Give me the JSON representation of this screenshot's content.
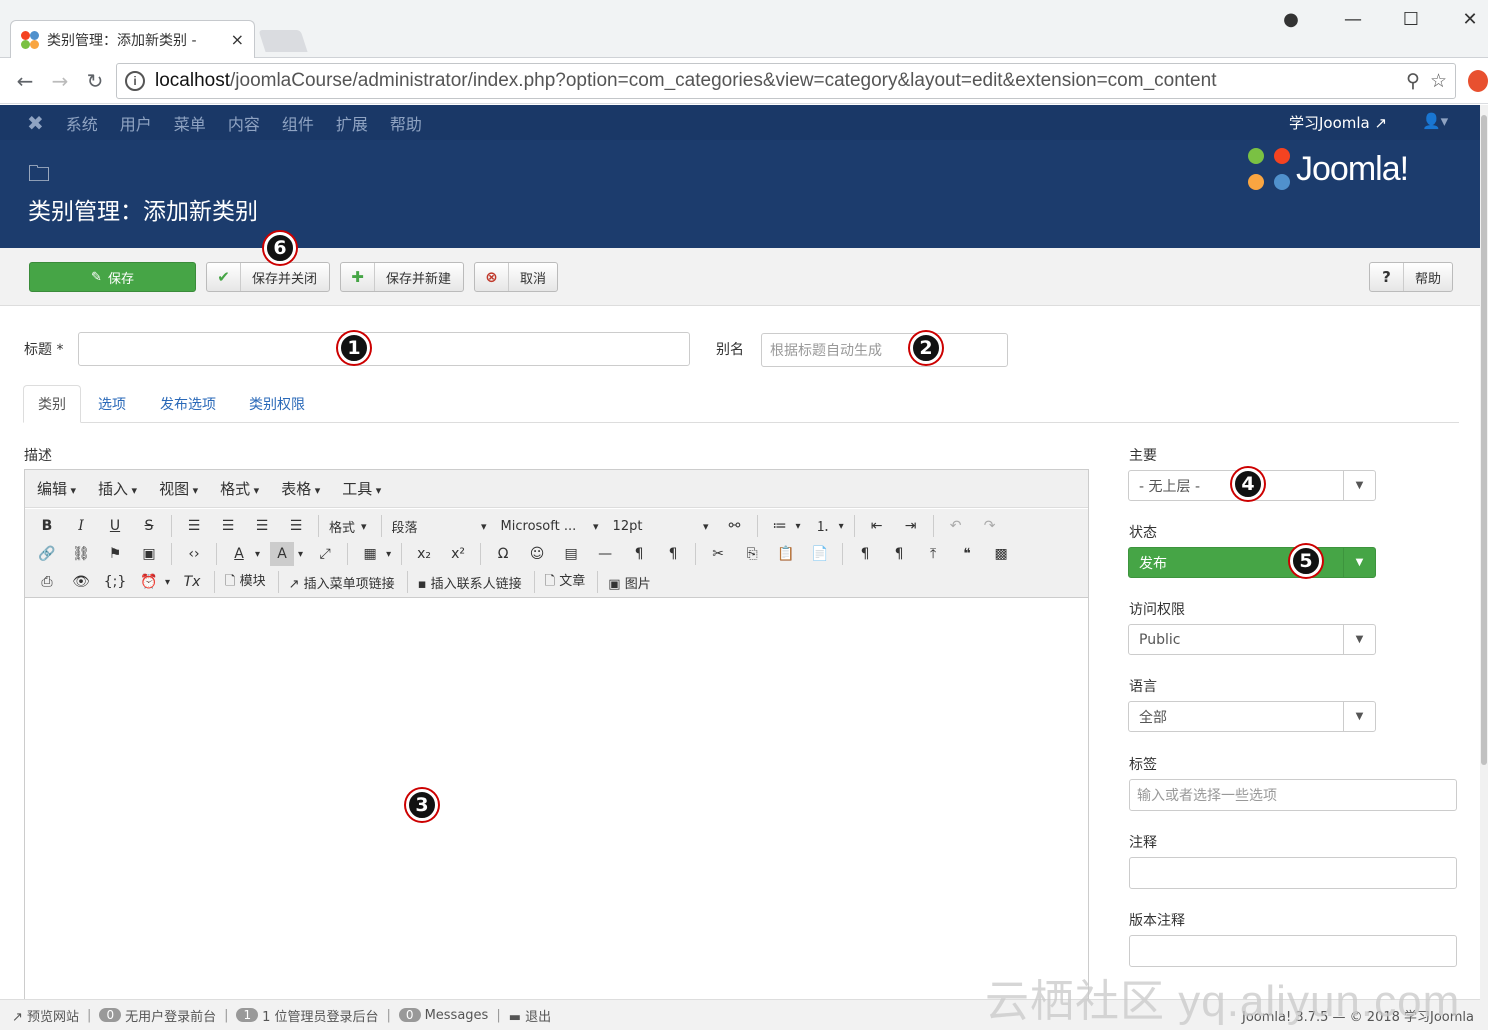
{
  "browser": {
    "tab_title": "类别管理：添加新类别 -",
    "tab_close": "×",
    "url_host": "localhost",
    "url_path": "/joomlaCourse/administrator/index.php?option=com_categories&view=category&layout=edit&extension=com_content",
    "info_icon": "i"
  },
  "admin_menu": {
    "items": [
      "系统",
      "用户",
      "菜单",
      "内容",
      "组件",
      "扩展",
      "帮助"
    ],
    "site_link": "学习Joomla"
  },
  "header": {
    "page_title": "类别管理：添加新类别",
    "logo_text": "Joomla!"
  },
  "toolbar": {
    "save": "保存",
    "save_close": "保存并关闭",
    "save_new": "保存并新建",
    "cancel": "取消",
    "help": "帮助"
  },
  "form": {
    "title_label": "标题 *",
    "alias_label": "别名",
    "alias_placeholder": "根据标题自动生成",
    "tabs": [
      "类别",
      "选项",
      "发布选项",
      "类别权限"
    ],
    "description_label": "描述"
  },
  "editor": {
    "menus": [
      "编辑",
      "插入",
      "视图",
      "格式",
      "表格",
      "工具"
    ],
    "formats_label": "格式",
    "block_label": "段落",
    "font_label": "Microsoft ...",
    "size_label": "12pt",
    "module_btn": "模块",
    "menu_link_btn": "插入菜单项链接",
    "contact_link_btn": "插入联系人链接",
    "article_btn": "文章",
    "image_btn": "图片"
  },
  "sidebar": {
    "parent_label": "主要",
    "parent_value": "- 无上层 -",
    "status_label": "状态",
    "status_value": "发布",
    "access_label": "访问权限",
    "access_value": "Public",
    "language_label": "语言",
    "language_value": "全部",
    "tags_label": "标签",
    "tags_placeholder": "输入或者选择一些选项",
    "note_label": "注释",
    "version_note_label": "版本注释"
  },
  "badges": [
    "1",
    "2",
    "3",
    "4",
    "5",
    "6"
  ],
  "footer": {
    "preview": "预览网站",
    "count_visitors": "0",
    "visitors_text": "无用户登录前台",
    "count_admins": "1",
    "admins_text": "1 位管理员登录后台",
    "count_messages": "0",
    "messages_text": "Messages",
    "logout": "退出",
    "version": "Joomla! 3.7.5 — © 2018 学习Joomla"
  },
  "watermark": "云栖社区 yq.aliyun.com",
  "colors": {
    "joomla_nav": "#1a3867",
    "joomla_header": "#1c3c6d",
    "save_green": "#46a546",
    "link_blue": "#2a69b8"
  }
}
